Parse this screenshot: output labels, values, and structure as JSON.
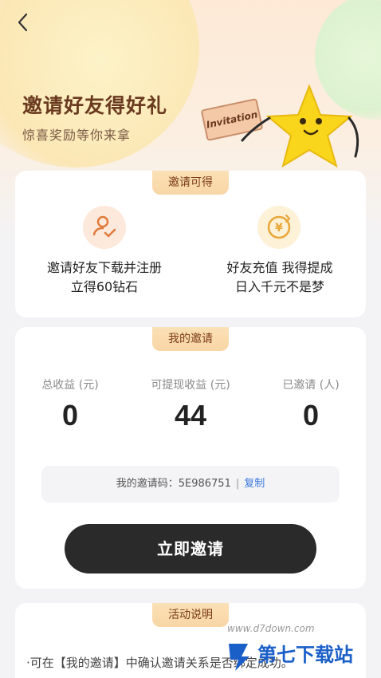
{
  "hero": {
    "title": "邀请好友得好礼",
    "subtitle": "惊喜奖励等你来拿",
    "tag": "Invitation"
  },
  "benefits": {
    "tab": "邀请可得",
    "items": [
      {
        "icon": "user-check-icon",
        "line1": "邀请好友下载并注册",
        "line2": "立得60钻石"
      },
      {
        "icon": "yen-coin-icon",
        "line1": "好友充值 我得提成",
        "line2": "日入千元不是梦"
      }
    ]
  },
  "my_invites": {
    "tab": "我的邀请",
    "stats": [
      {
        "label": "总收益 (元)",
        "value": "0"
      },
      {
        "label": "可提现收益 (元)",
        "value": "44"
      },
      {
        "label": "已邀请 (人)",
        "value": "0"
      }
    ],
    "code_label": "我的邀请码：",
    "code_value": "5E986751",
    "code_sep": "|",
    "copy_label": "复制",
    "invite_button": "立即邀请"
  },
  "activity": {
    "tab": "活动说明",
    "rule_text": "·可在【我的邀请】中确认邀请关系是否绑定成功。"
  },
  "watermark": {
    "text": "第七下载站",
    "url": "www.d7down.com"
  },
  "colors": {
    "accent": "#2a2a2a",
    "tab": "#f8d6a5",
    "link": "#3b79e0"
  }
}
